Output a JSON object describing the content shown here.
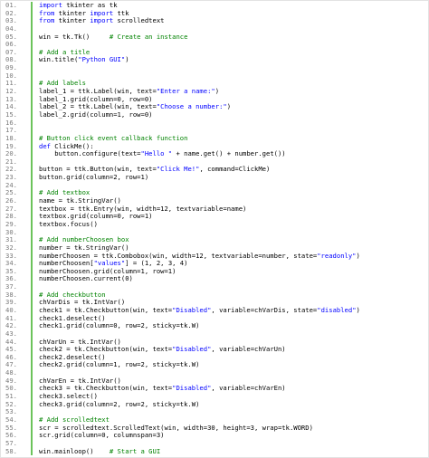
{
  "colors": {
    "background": "#ffffff",
    "gutter_bar": "#6cc35b",
    "line_number": "#7a7a7a",
    "keyword": "#0000ff",
    "string": "#0000ff",
    "comment": "#008200",
    "plain": "#000000"
  },
  "lines": [
    {
      "n": "01.",
      "t": [
        [
          "kw",
          "import"
        ],
        [
          "plain",
          " tkinter as tk"
        ]
      ]
    },
    {
      "n": "02.",
      "t": [
        [
          "kw",
          "from"
        ],
        [
          "plain",
          " tkinter "
        ],
        [
          "kw",
          "import"
        ],
        [
          "plain",
          " ttk"
        ]
      ]
    },
    {
      "n": "03.",
      "t": [
        [
          "kw",
          "from"
        ],
        [
          "plain",
          " tkinter "
        ],
        [
          "kw",
          "import"
        ],
        [
          "plain",
          " scrolledtext"
        ]
      ]
    },
    {
      "n": "04.",
      "t": []
    },
    {
      "n": "05.",
      "t": [
        [
          "plain",
          "win = tk.Tk()     "
        ],
        [
          "cm",
          "# Create an instance"
        ]
      ]
    },
    {
      "n": "06.",
      "t": []
    },
    {
      "n": "07.",
      "t": [
        [
          "cm",
          "# Add a title"
        ]
      ]
    },
    {
      "n": "08.",
      "t": [
        [
          "plain",
          "win.title("
        ],
        [
          "str",
          "\"Python GUI\""
        ],
        [
          "plain",
          ")"
        ]
      ]
    },
    {
      "n": "09.",
      "t": []
    },
    {
      "n": "10.",
      "t": []
    },
    {
      "n": "11.",
      "t": [
        [
          "cm",
          "# Add labels"
        ]
      ]
    },
    {
      "n": "12.",
      "t": [
        [
          "plain",
          "label_1 = ttk.Label(win, text="
        ],
        [
          "str",
          "\"Enter a name:\""
        ],
        [
          "plain",
          ")"
        ]
      ]
    },
    {
      "n": "13.",
      "t": [
        [
          "plain",
          "label_1.grid(column=0, row=0)"
        ]
      ]
    },
    {
      "n": "14.",
      "t": [
        [
          "plain",
          "label_2 = ttk.Label(win, text="
        ],
        [
          "str",
          "\"Choose a number:\""
        ],
        [
          "plain",
          ")"
        ]
      ]
    },
    {
      "n": "15.",
      "t": [
        [
          "plain",
          "label_2.grid(column=1, row=0)"
        ]
      ]
    },
    {
      "n": "16.",
      "t": []
    },
    {
      "n": "17.",
      "t": []
    },
    {
      "n": "18.",
      "t": [
        [
          "cm",
          "# Button click event callback function"
        ]
      ]
    },
    {
      "n": "19.",
      "t": [
        [
          "kw",
          "def"
        ],
        [
          "plain",
          " ClickMe():"
        ]
      ]
    },
    {
      "n": "20.",
      "t": [
        [
          "plain",
          "    button.configure(text="
        ],
        [
          "str",
          "\"Hello \""
        ],
        [
          "plain",
          " + name.get() + number.get())"
        ]
      ]
    },
    {
      "n": "21.",
      "t": []
    },
    {
      "n": "22.",
      "t": [
        [
          "plain",
          "button = ttk.Button(win, text="
        ],
        [
          "str",
          "\"Click Me!\""
        ],
        [
          "plain",
          ", command=ClickMe)"
        ]
      ]
    },
    {
      "n": "23.",
      "t": [
        [
          "plain",
          "button.grid(column=2, row=1)"
        ]
      ]
    },
    {
      "n": "24.",
      "t": []
    },
    {
      "n": "25.",
      "t": [
        [
          "cm",
          "# Add textbox"
        ]
      ]
    },
    {
      "n": "26.",
      "t": [
        [
          "plain",
          "name = tk.StringVar()"
        ]
      ]
    },
    {
      "n": "27.",
      "t": [
        [
          "plain",
          "textbox = ttk.Entry(win, width=12, textvariable=name)"
        ]
      ]
    },
    {
      "n": "28.",
      "t": [
        [
          "plain",
          "textbox.grid(column=0, row=1)"
        ]
      ]
    },
    {
      "n": "29.",
      "t": [
        [
          "plain",
          "textbox.focus()"
        ]
      ]
    },
    {
      "n": "30.",
      "t": []
    },
    {
      "n": "31.",
      "t": [
        [
          "cm",
          "# Add numberChoosen box"
        ]
      ]
    },
    {
      "n": "32.",
      "t": [
        [
          "plain",
          "number = tk.StringVar()"
        ]
      ]
    },
    {
      "n": "33.",
      "t": [
        [
          "plain",
          "numberChoosen = ttk.Combobox(win, width=12, textvariable=number, state="
        ],
        [
          "str",
          "\"readonly\""
        ],
        [
          "plain",
          ")"
        ]
      ]
    },
    {
      "n": "34.",
      "t": [
        [
          "plain",
          "numberChoosen["
        ],
        [
          "str",
          "\"values\""
        ],
        [
          "plain",
          "] = (1, 2, 3, 4)"
        ]
      ]
    },
    {
      "n": "35.",
      "t": [
        [
          "plain",
          "numberChoosen.grid(column=1, row=1)"
        ]
      ]
    },
    {
      "n": "36.",
      "t": [
        [
          "plain",
          "numberChoosen.current(0)"
        ]
      ]
    },
    {
      "n": "37.",
      "t": []
    },
    {
      "n": "38.",
      "t": [
        [
          "cm",
          "# Add checkbutton"
        ]
      ]
    },
    {
      "n": "39.",
      "t": [
        [
          "plain",
          "chVarDis = tk.IntVar()"
        ]
      ]
    },
    {
      "n": "40.",
      "t": [
        [
          "plain",
          "check1 = tk.Checkbutton(win, text="
        ],
        [
          "str",
          "\"Disabled\""
        ],
        [
          "plain",
          ", variable=chVarDis, state="
        ],
        [
          "str",
          "\"disabled\""
        ],
        [
          "plain",
          ")"
        ]
      ]
    },
    {
      "n": "41.",
      "t": [
        [
          "plain",
          "check1.deselect()"
        ]
      ]
    },
    {
      "n": "42.",
      "t": [
        [
          "plain",
          "check1.grid(column=0, row=2, sticky=tk.W)"
        ]
      ]
    },
    {
      "n": "43.",
      "t": []
    },
    {
      "n": "44.",
      "t": [
        [
          "plain",
          "chVarUn = tk.IntVar()"
        ]
      ]
    },
    {
      "n": "45.",
      "t": [
        [
          "plain",
          "check2 = tk.Checkbutton(win, text="
        ],
        [
          "str",
          "\"Disabled\""
        ],
        [
          "plain",
          ", variable=chVarUn)"
        ]
      ]
    },
    {
      "n": "46.",
      "t": [
        [
          "plain",
          "check2.deselect()"
        ]
      ]
    },
    {
      "n": "47.",
      "t": [
        [
          "plain",
          "check2.grid(column=1, row=2, sticky=tk.W)"
        ]
      ]
    },
    {
      "n": "48.",
      "t": []
    },
    {
      "n": "49.",
      "t": [
        [
          "plain",
          "chVarEn = tk.IntVar()"
        ]
      ]
    },
    {
      "n": "50.",
      "t": [
        [
          "plain",
          "check3 = tk.Checkbutton(win, text="
        ],
        [
          "str",
          "\"Disabled\""
        ],
        [
          "plain",
          ", variable=chVarEn)"
        ]
      ]
    },
    {
      "n": "51.",
      "t": [
        [
          "plain",
          "check3.select()"
        ]
      ]
    },
    {
      "n": "52.",
      "t": [
        [
          "plain",
          "check3.grid(column=2, row=2, sticky=tk.W)"
        ]
      ]
    },
    {
      "n": "53.",
      "t": []
    },
    {
      "n": "54.",
      "t": [
        [
          "cm",
          "# Add scrolledtext"
        ]
      ]
    },
    {
      "n": "55.",
      "t": [
        [
          "plain",
          "scr = scrolledtext.ScrolledText(win, width=30, height=3, wrap=tk.WORD)"
        ]
      ]
    },
    {
      "n": "56.",
      "t": [
        [
          "plain",
          "scr.grid(column=0, columnspan=3)"
        ]
      ]
    },
    {
      "n": "57.",
      "t": []
    },
    {
      "n": "58.",
      "t": [
        [
          "plain",
          "win.mainloop()    "
        ],
        [
          "cm",
          "# Start a GUI"
        ]
      ]
    }
  ]
}
